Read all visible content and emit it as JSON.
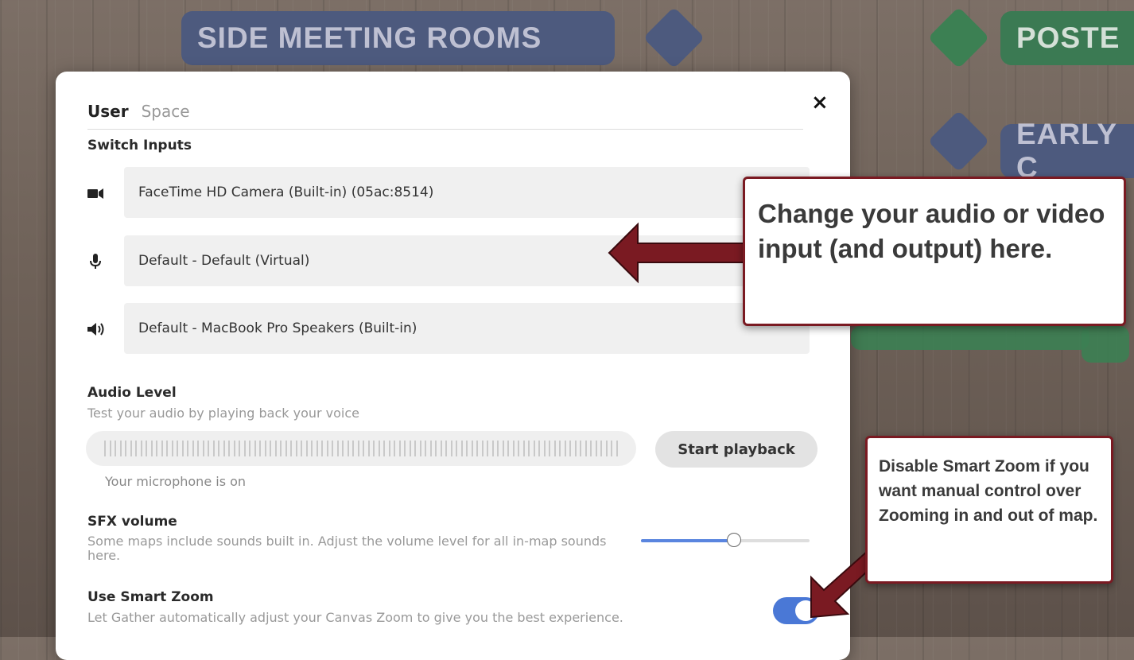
{
  "background": {
    "signs": {
      "side_meeting_rooms": "SIDE MEETING ROOMS",
      "poster": "POSTE",
      "early": "EARLY C"
    }
  },
  "modal": {
    "tabs": [
      "User",
      "Space"
    ],
    "active_tab": "User",
    "close_label": "×",
    "switch_inputs": {
      "title": "Switch Inputs",
      "camera": "FaceTime HD Camera (Built-in) (05ac:8514)",
      "microphone": "Default - Default (Virtual)",
      "speaker": "Default - MacBook Pro Speakers (Built-in)"
    },
    "audio_level": {
      "title": "Audio Level",
      "description": "Test your audio by playing back your voice",
      "playback_label": "Start playback",
      "mic_status": "Your microphone is on"
    },
    "sfx_volume": {
      "title": "SFX volume",
      "description": "Some maps include sounds built in. Adjust the volume level for all in-map sounds here.",
      "level": 0.55
    },
    "smart_zoom": {
      "title": "Use Smart Zoom",
      "description": "Let Gather automatically adjust your Canvas Zoom to give you the best experience.",
      "enabled": true
    }
  },
  "annotations": {
    "callout_inputs": "Change your audio or video input (and output) here.",
    "callout_zoom": "Disable Smart Zoom if you want manual control over Zooming in and out of map."
  },
  "colors": {
    "accent": "#4a78d6",
    "callout_border": "#7a1a22",
    "arrow": "#7a1a22"
  },
  "icons": [
    "video-camera-icon",
    "microphone-icon",
    "speaker-icon",
    "close-icon"
  ]
}
